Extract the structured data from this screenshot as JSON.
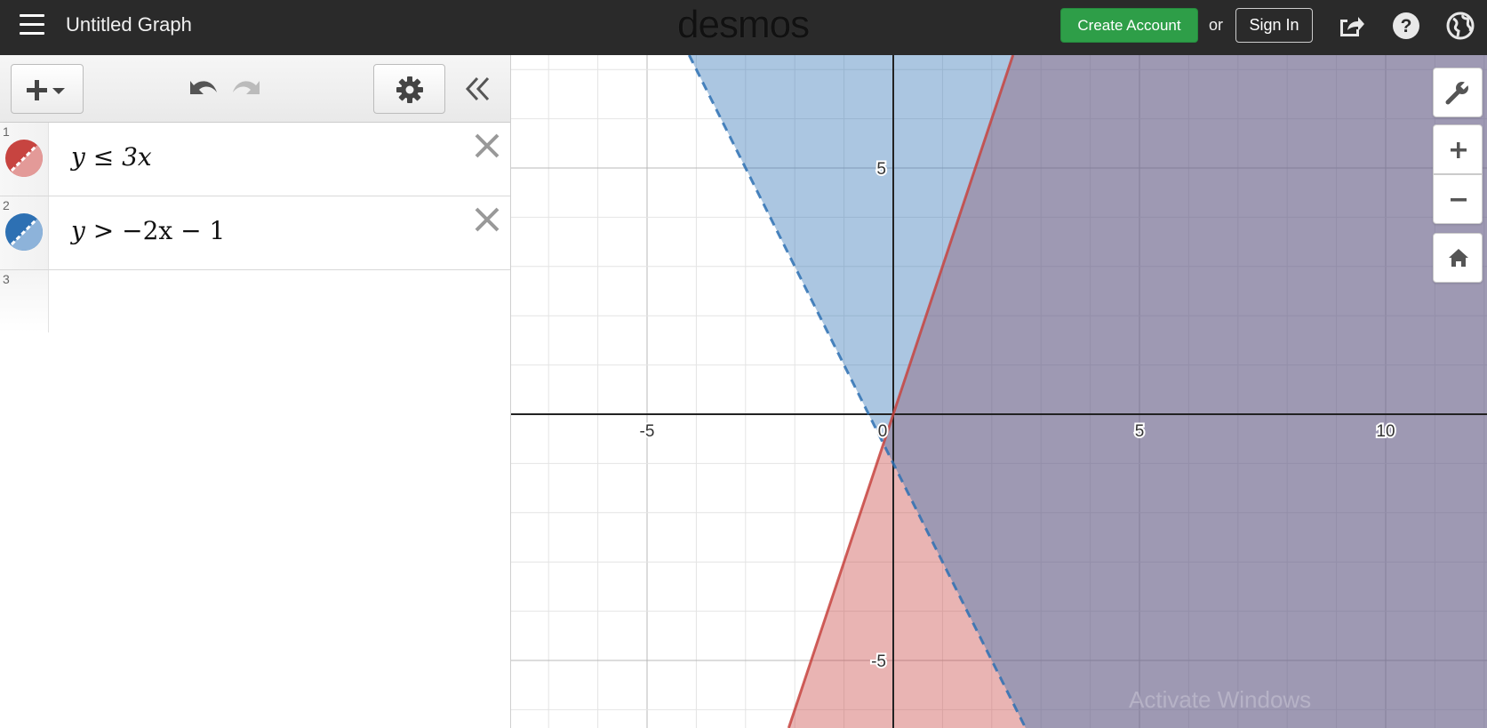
{
  "header": {
    "title": "Untitled Graph",
    "logo": "desmos",
    "create_account": "Create Account",
    "or": "or",
    "sign_in": "Sign In"
  },
  "expressions": [
    {
      "number": "1",
      "lhs": "y",
      "op": "≤",
      "rhs": "3x",
      "color": "#c74440",
      "style": "dashed-icon"
    },
    {
      "number": "2",
      "lhs": "y",
      "op": ">",
      "rhs": "−2x − 1",
      "color": "#2d70b3",
      "style": "dashed-icon"
    },
    {
      "number": "3",
      "lhs": "",
      "op": "",
      "rhs": ""
    }
  ],
  "graph": {
    "x_ticks": [
      "-5",
      "0",
      "5",
      "10"
    ],
    "y_ticks": [
      "5",
      "-5"
    ],
    "inequalities": [
      {
        "expr": "y <= 3x",
        "color": "#c74440",
        "boundary": "solid"
      },
      {
        "expr": "y > -2x - 1",
        "color": "#2d70b3",
        "boundary": "dashed"
      }
    ],
    "watermark": "Activate Windows"
  },
  "icons": {
    "menu": "hamburger-icon",
    "share": "share-icon",
    "help": "help-icon",
    "language": "globe-icon",
    "add": "plus-dropdown-icon",
    "undo": "undo-icon",
    "redo": "redo-icon",
    "settings": "gear-icon",
    "collapse": "double-chevron-left-icon",
    "wrench": "wrench-icon",
    "zoom_in": "plus-icon",
    "zoom_out": "minus-icon",
    "home": "home-icon"
  }
}
